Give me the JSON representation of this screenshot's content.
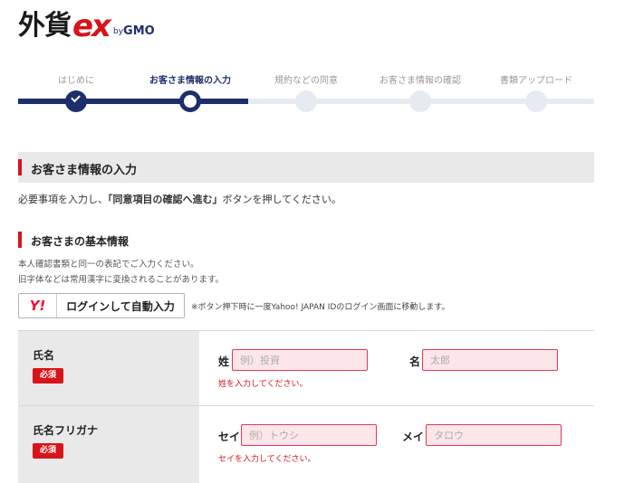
{
  "logo": {
    "main": "外貨",
    "ex": "ex",
    "by": "by",
    "gmo": "GMO"
  },
  "steps": [
    {
      "label": "はじめに",
      "state": "done"
    },
    {
      "label": "お客さま情報の入力",
      "state": "current"
    },
    {
      "label": "規約などの同意",
      "state": "todo"
    },
    {
      "label": "お客さま情報の確認",
      "state": "todo"
    },
    {
      "label": "書類アップロード",
      "state": "todo"
    }
  ],
  "section": {
    "title": "お客さま情報の入力"
  },
  "instruction": {
    "before": "必要事項を入力し、",
    "strong": "「同意項目の確認へ進む」",
    "after": "ボタンを押してください。"
  },
  "basic_info": {
    "title": "お客さまの基本情報",
    "note1": "本人確認書類と同一の表記でご入力ください。",
    "note2": "旧字体などは常用漢字に変換されることがあります。"
  },
  "yahoo": {
    "logo": "Y!",
    "label": "ログインして自動入力",
    "note": "※ボタン押下時に一度Yahoo! JAPAN IDのログイン画面に移動します。"
  },
  "colors": {
    "brand_navy": "#1c2f6b",
    "accent_red": "#d7141a",
    "input_error_bg": "#fde6ea"
  },
  "form": {
    "name": {
      "label": "氏名",
      "required": "必須",
      "last_label": "姓",
      "last_placeholder": "例）投資",
      "last_error": "姓を入力してください。",
      "first_label": "名",
      "first_placeholder": "太郎"
    },
    "kana": {
      "label": "氏名フリガナ",
      "required": "必須",
      "last_label": "セイ",
      "last_placeholder": "例）トウシ",
      "last_error": "セイを入力してください。",
      "first_label": "メイ",
      "first_placeholder": "タロウ"
    }
  }
}
